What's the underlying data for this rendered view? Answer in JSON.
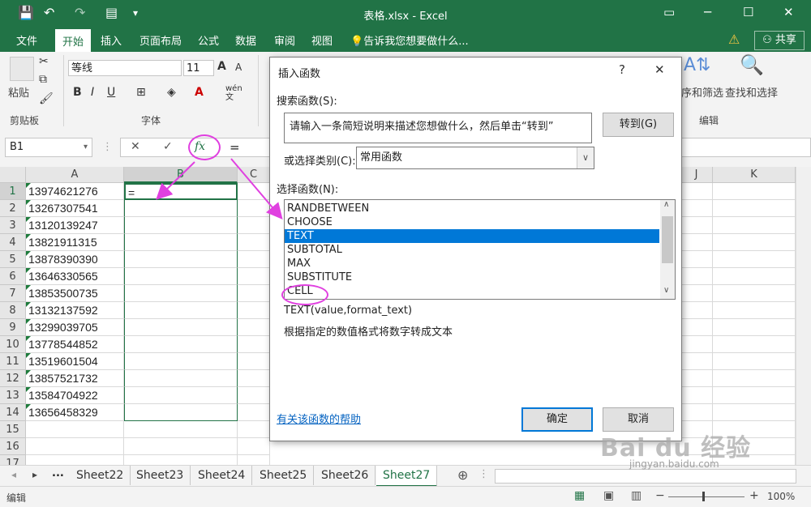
{
  "window": {
    "title": "表格.xlsx - Excel",
    "controls": [
      "▭",
      "─",
      "☐",
      "✕"
    ]
  },
  "quick_access": {
    "save": "💾",
    "undo": "↶",
    "redo": "↷",
    "form": "▤",
    "more": "▾"
  },
  "ribbon_tabs": [
    "文件",
    "开始",
    "插入",
    "页面布局",
    "公式",
    "数据",
    "审阅",
    "视图"
  ],
  "active_tab": "开始",
  "tell_me": "告诉我您想要做什么...",
  "share": "共享",
  "ribbon": {
    "clipboard_group": "剪贴板",
    "paste_label": "粘贴",
    "font_group": "字体",
    "font_name": "等线",
    "font_size": "11",
    "bold": "B",
    "italic": "I",
    "underline": "U",
    "grow_font": "A",
    "shrink_font": "A",
    "font_color_glyph": "A",
    "phonetic": "wén\n文",
    "sort_filter_label": "序和筛选",
    "find_select_label": "查找和选择",
    "editing_group": "编辑"
  },
  "formula_bar": {
    "name_box": "B1",
    "cancel": "✕",
    "enter": "✓",
    "fx": "fx",
    "content": "="
  },
  "grid": {
    "columns": [
      "A",
      "B",
      "C",
      "J",
      "K"
    ],
    "rows": [
      "1",
      "2",
      "3",
      "4",
      "5",
      "6",
      "7",
      "8",
      "9",
      "10",
      "11",
      "12",
      "13",
      "14",
      "15",
      "16",
      "17"
    ],
    "col_a_values": [
      "13974621276",
      "13267307541",
      "13120139247",
      "13821911315",
      "13878390390",
      "13646330565",
      "13853500735",
      "13132137592",
      "13299039705",
      "13778544852",
      "13519601504",
      "13857521732",
      "13584704922",
      "13656458329"
    ],
    "b1_value": "="
  },
  "sheets": {
    "nav_prev": "◂",
    "nav_next": "▸",
    "ellipsis": "...",
    "tabs": [
      "Sheet22",
      "Sheet23",
      "Sheet24",
      "Sheet25",
      "Sheet26",
      "Sheet27"
    ],
    "active": "Sheet27",
    "add": "⊕"
  },
  "status": {
    "mode": "编辑",
    "zoom": "100%",
    "minus": "−",
    "plus": "+"
  },
  "dialog": {
    "title": "插入函数",
    "help_btn": "?",
    "close_btn": "✕",
    "search_label": "搜索函数(S):",
    "search_value": "请输入一条简短说明来描述您想做什么，然后单击“转到”",
    "go_button": "转到(G)",
    "category_label": "或选择类别(C):",
    "category_value": "常用函数",
    "select_label": "选择函数(N):",
    "functions": [
      "RANDBETWEEN",
      "CHOOSE",
      "TEXT",
      "SUBTOTAL",
      "MAX",
      "SUBSTITUTE",
      "CELL"
    ],
    "selected_function": "TEXT",
    "syntax": "TEXT(value,format_text)",
    "description": "根据指定的数值格式将数字转成文本",
    "help_link": "有关该函数的帮助",
    "ok": "确定",
    "cancel": "取消"
  },
  "watermark": {
    "brand": "Bai du 经验",
    "url": "jingyan.baidu.com"
  },
  "colors": {
    "excel_green": "#217346",
    "selection_blue": "#0078d7",
    "annotation": "#e040e0"
  }
}
